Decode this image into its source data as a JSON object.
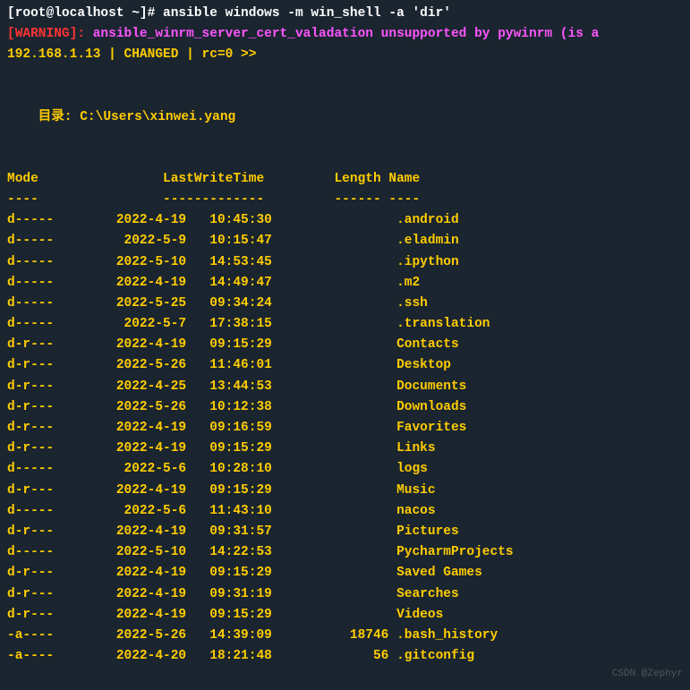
{
  "prompt": "[root@localhost ~]# ansible windows -m win_shell -a 'dir'",
  "warning_label": "[WARNING]: ",
  "warning_text": "ansible_winrm_server_cert_valadation unsupported by pywinrm (is a",
  "status": "192.168.1.13 | CHANGED | rc=0 >>",
  "dir_label": "    目录: C:\\Users\\xinwei.yang",
  "header": "Mode                LastWriteTime         Length Name",
  "header_sep": "----                -------------         ------ ----",
  "rows": [
    "d-----        2022-4-19   10:45:30                .android",
    "d-----         2022-5-9   10:15:47                .eladmin",
    "d-----        2022-5-10   14:53:45                .ipython",
    "d-----        2022-4-19   14:49:47                .m2",
    "d-----        2022-5-25   09:34:24                .ssh",
    "d-----         2022-5-7   17:38:15                .translation",
    "d-r---        2022-4-19   09:15:29                Contacts",
    "d-r---        2022-5-26   11:46:01                Desktop",
    "d-r---        2022-4-25   13:44:53                Documents",
    "d-r---        2022-5-26   10:12:38                Downloads",
    "d-r---        2022-4-19   09:16:59                Favorites",
    "d-r---        2022-4-19   09:15:29                Links",
    "d-----         2022-5-6   10:28:10                logs",
    "d-r---        2022-4-19   09:15:29                Music",
    "d-----         2022-5-6   11:43:10                nacos",
    "d-r---        2022-4-19   09:31:57                Pictures",
    "d-----        2022-5-10   14:22:53                PycharmProjects",
    "d-r---        2022-4-19   09:15:29                Saved Games",
    "d-r---        2022-4-19   09:31:19                Searches",
    "d-r---        2022-4-19   09:15:29                Videos",
    "-a----        2022-5-26   14:39:09          18746 .bash_history",
    "-a----        2022-4-20   18:21:48             56 .gitconfig"
  ],
  "watermark": "CSDN @Zephyr"
}
